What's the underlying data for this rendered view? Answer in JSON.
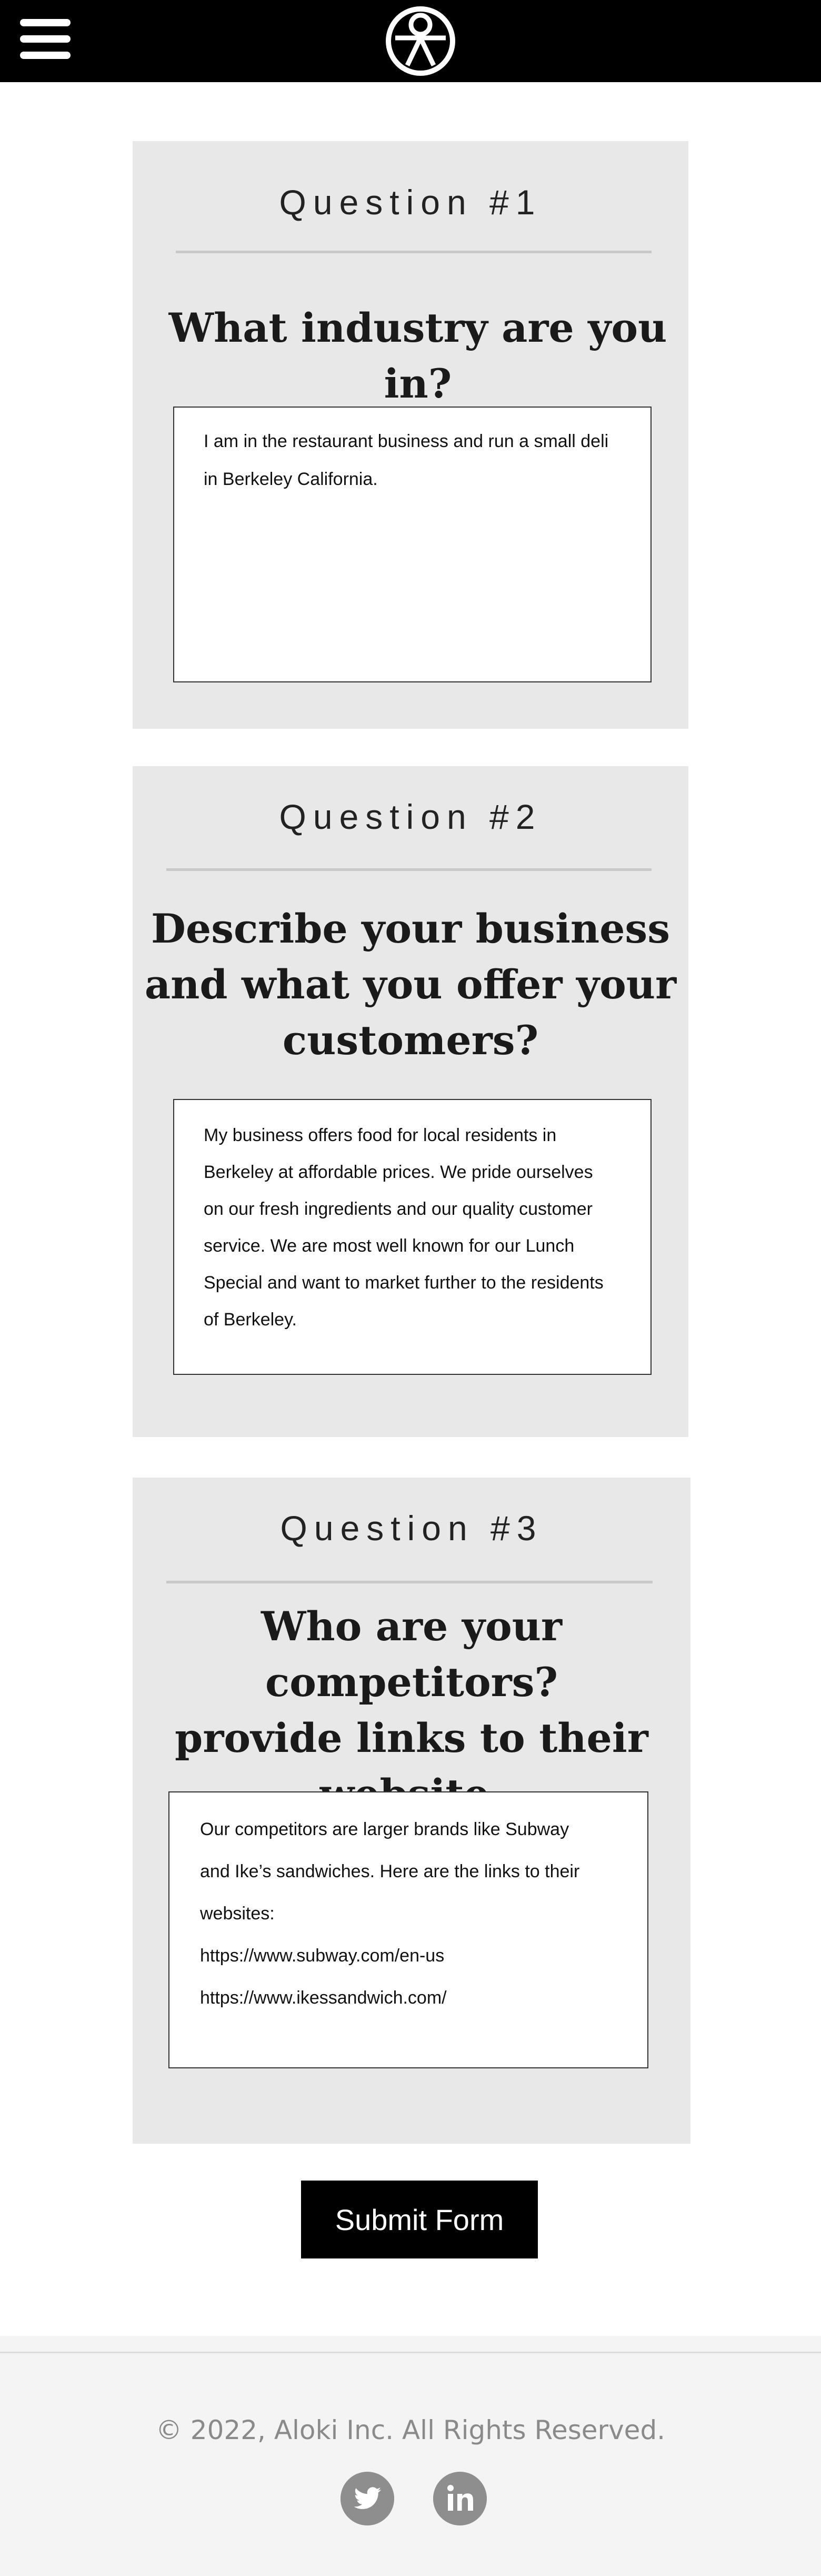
{
  "header": {
    "menu_icon": "hamburger-menu-icon",
    "logo_icon": "aloki-logo-icon"
  },
  "questions": [
    {
      "number": "Question #1",
      "title_lines": [
        "What industry are you in?"
      ],
      "answer_lines": [
        "I am in the restaurant business and run a small deli",
        "in Berkeley California."
      ]
    },
    {
      "number": "Question #2",
      "title_lines": [
        "Describe your business",
        "and what you offer your",
        "customers?"
      ],
      "answer_lines": [
        "My business offers food for local residents in",
        "Berkeley at affordable prices. We pride ourselves",
        "on our fresh ingredients and our quality customer",
        "service. We are most well known for our Lunch",
        "Special and want to market further to the residents",
        "of Berkeley."
      ]
    },
    {
      "number": "Question #3",
      "title_lines": [
        "Who are your competitors?",
        "provide links to their",
        "website."
      ],
      "answer_lines": [
        "Our competitors are larger brands like Subway",
        "and Ike’s sandwiches.  Here are the links to their",
        "websites:",
        "https://www.subway.com/en-us",
        "https://www.ikessandwich.com/"
      ]
    }
  ],
  "submit": {
    "label": "Submit Form"
  },
  "footer": {
    "copyright": "© 2022, Aloki Inc. All Rights Reserved.",
    "social": [
      "twitter-icon",
      "linkedin-icon"
    ]
  },
  "colors": {
    "header_bg": "#000000",
    "card_bg": "#e8e8e8",
    "footer_bg": "#f4f4f4",
    "social_icon": "#8e8e8e"
  }
}
